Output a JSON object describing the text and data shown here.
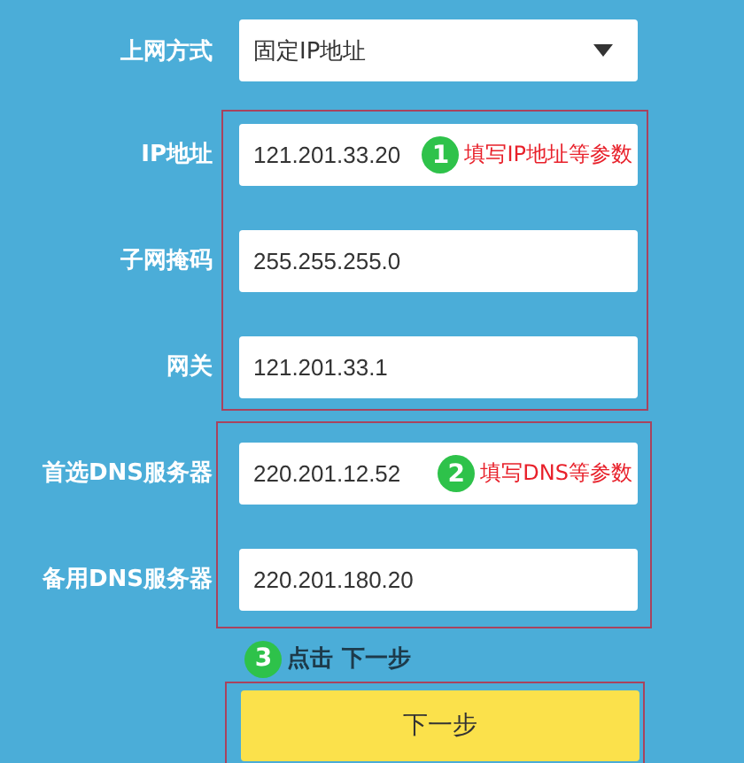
{
  "connection_type": {
    "label": "上网方式",
    "value": "固定IP地址"
  },
  "groups": [
    {
      "step": "1",
      "note": "填写IP地址等参数",
      "fields": [
        {
          "label": "IP地址",
          "value": "121.201.33.20"
        },
        {
          "label": "子网掩码",
          "value": "255.255.255.0"
        },
        {
          "label": "网关",
          "value": "121.201.33.1"
        }
      ]
    },
    {
      "step": "2",
      "note": "填写DNS等参数",
      "fields": [
        {
          "label": "首选DNS服务器",
          "value": "220.201.12.52"
        },
        {
          "label": "备用DNS服务器",
          "value": "220.201.180.20"
        }
      ]
    }
  ],
  "step_hint": {
    "step": "3",
    "text": "点击 下一步"
  },
  "next_button": {
    "label": "下一步"
  }
}
